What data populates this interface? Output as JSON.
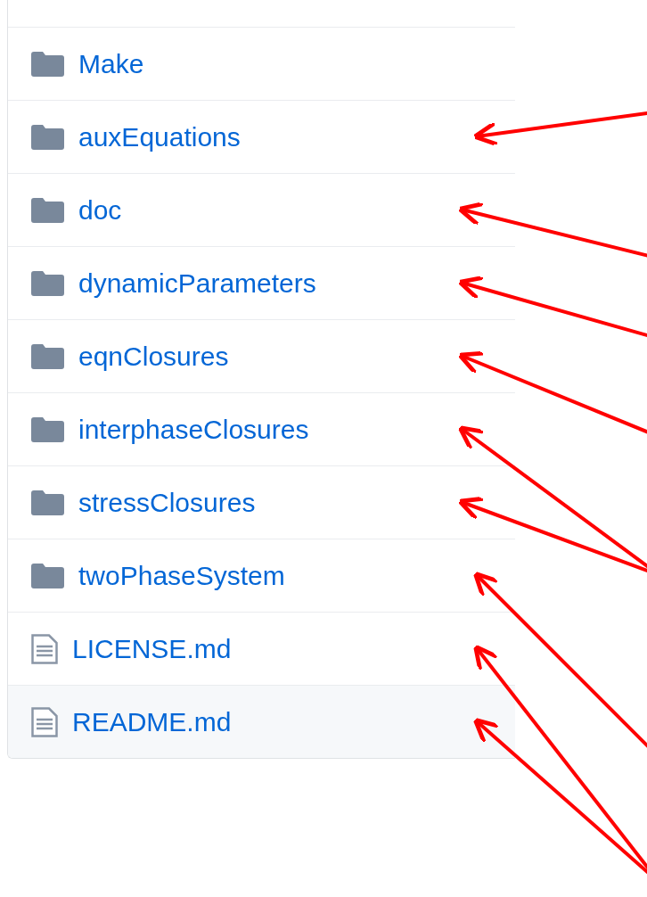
{
  "files": [
    {
      "name": "Make",
      "kind": "folder",
      "highlighted": false,
      "annotated": false
    },
    {
      "name": "auxEquations",
      "kind": "folder",
      "highlighted": false,
      "annotated": true
    },
    {
      "name": "doc",
      "kind": "folder",
      "highlighted": false,
      "annotated": true
    },
    {
      "name": "dynamicParameters",
      "kind": "folder",
      "highlighted": false,
      "annotated": true
    },
    {
      "name": "eqnClosures",
      "kind": "folder",
      "highlighted": false,
      "annotated": true
    },
    {
      "name": "interphaseClosures",
      "kind": "folder",
      "highlighted": false,
      "annotated": true
    },
    {
      "name": "stressClosures",
      "kind": "folder",
      "highlighted": false,
      "annotated": true
    },
    {
      "name": "twoPhaseSystem",
      "kind": "folder",
      "highlighted": false,
      "annotated": true
    },
    {
      "name": "LICENSE.md",
      "kind": "file",
      "highlighted": false,
      "annotated": true
    },
    {
      "name": "README.md",
      "kind": "file",
      "highlighted": true,
      "annotated": true
    }
  ]
}
